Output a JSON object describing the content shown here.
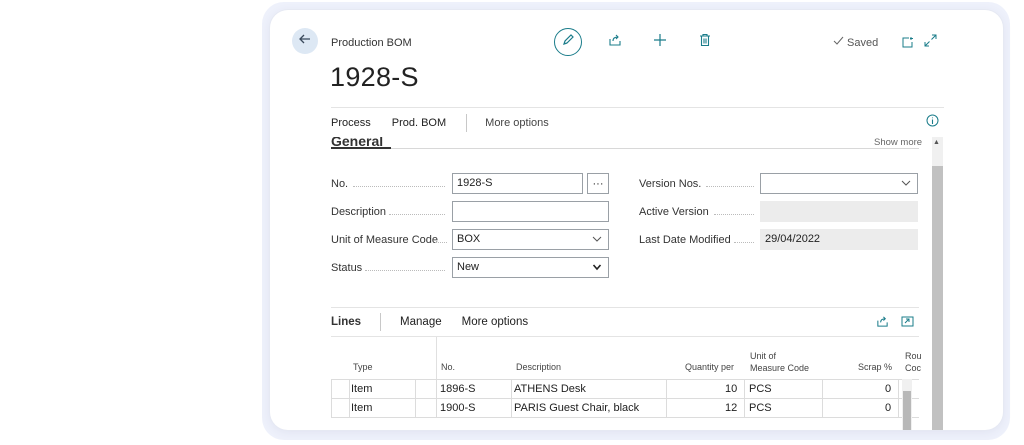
{
  "header": {
    "caption": "Production BOM",
    "title": "1928-S",
    "saved_label": "Saved"
  },
  "actionbar": {
    "items": [
      "Process",
      "Prod. BOM"
    ],
    "more": "More options"
  },
  "general": {
    "title": "General",
    "show_more": "Show more",
    "fields": {
      "no_label": "No.",
      "no_value": "1928-S",
      "description_label": "Description",
      "description_value": "",
      "uom_label": "Unit of Measure Code",
      "uom_value": "BOX",
      "status_label": "Status",
      "status_value": "New",
      "version_nos_label": "Version Nos.",
      "version_nos_value": "",
      "active_version_label": "Active Version",
      "active_version_value": "",
      "last_modified_label": "Last Date Modified",
      "last_modified_value": "29/04/2022"
    },
    "ellipsis": "···"
  },
  "lines": {
    "title": "Lines",
    "manage": "Manage",
    "more": "More options",
    "columns": {
      "type": "Type",
      "no": "No.",
      "description": "Description",
      "quantity": "Quantity per",
      "uom_line1": "Unit of",
      "uom_line2": "Measure Code",
      "scrap": "Scrap %",
      "routing_line1": "Rou",
      "routing_line2": "Coc"
    },
    "rows": [
      {
        "type": "Item",
        "no": "1896-S",
        "description": "ATHENS Desk",
        "quantity": "10",
        "uom": "PCS",
        "scrap": "0"
      },
      {
        "type": "Item",
        "no": "1900-S",
        "description": "PARIS Guest Chair, black",
        "quantity": "12",
        "uom": "PCS",
        "scrap": "0"
      }
    ]
  },
  "icons": {
    "back": "arrow-left-icon",
    "edit": "pencil-icon",
    "share": "share-icon",
    "add": "plus-icon",
    "delete": "trash-icon",
    "saved": "checkmark-icon",
    "popout": "open-new-window-icon",
    "expand": "expand-icon",
    "info": "info-icon"
  },
  "colors": {
    "accent": "#1a7c8a",
    "back_button_bg": "#dde8f4"
  }
}
